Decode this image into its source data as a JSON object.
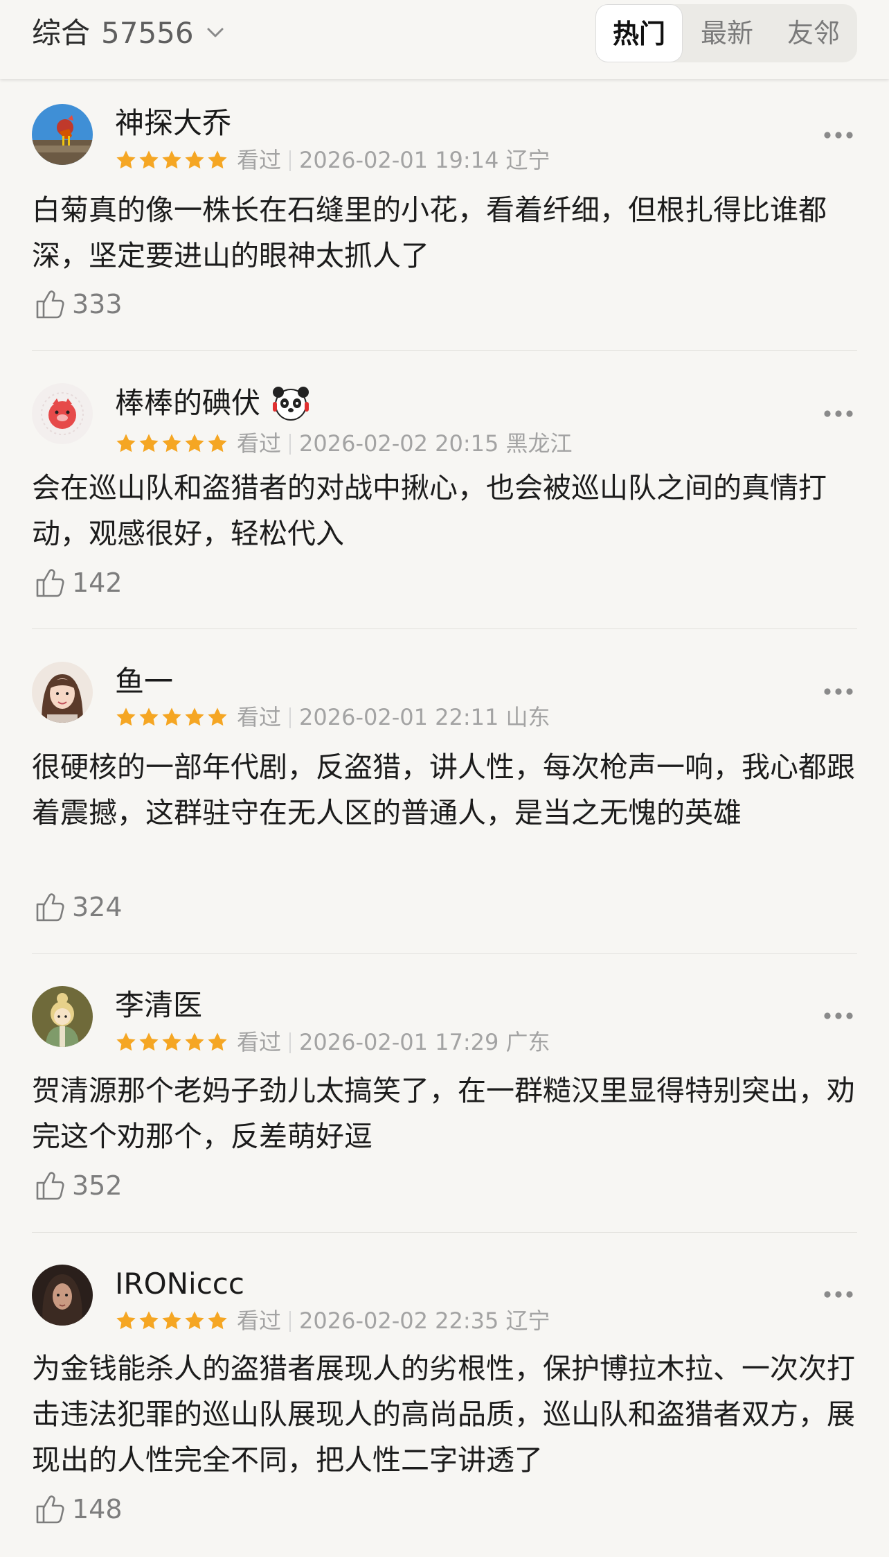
{
  "header": {
    "sort_label": "综合",
    "count": "57556",
    "tabs": [
      {
        "label": "热门",
        "active": true
      },
      {
        "label": "最新",
        "active": false
      },
      {
        "label": "友邻",
        "active": false
      }
    ]
  },
  "colors": {
    "star": "#f5a623",
    "muted": "#a3a3a3",
    "background": "#f7f6f3"
  },
  "comments": [
    {
      "name": "神探大乔",
      "rating": 5,
      "status": "看过",
      "meta": "2026-02-01 19:14 辽宁",
      "text": "白菊真的像一株长在石缝里的小花，看着纤细，但根扎得比谁都深，坚定要进山的眼神太抓人了",
      "likes": "333"
    },
    {
      "name": "棒棒的碘伏",
      "badge_icon": "panda-badge-icon",
      "rating": 5,
      "status": "看过",
      "meta": "2026-02-02 20:15 黑龙江",
      "text": "会在巡山队和盗猎者的对战中揪心，也会被巡山队之间的真情打动，观感很好，轻松代入",
      "likes": "142"
    },
    {
      "name": "鱼一",
      "rating": 5,
      "status": "看过",
      "meta": "2026-02-01 22:11 山东",
      "text": "很硬核的一部年代剧，反盗猎，讲人性，每次枪声一响，我心都跟着震撼，这群驻守在无人区的普通人，是当之无愧的英雄",
      "likes": "324"
    },
    {
      "name": "李清医",
      "rating": 5,
      "status": "看过",
      "meta": "2026-02-01 17:29 广东",
      "text": "贺清源那个老妈子劲儿太搞笑了，在一群糙汉里显得特别突出，劝完这个劝那个，反差萌好逗",
      "likes": "352"
    },
    {
      "name": "IRONiccc",
      "rating": 5,
      "status": "看过",
      "meta": "2026-02-02 22:35 辽宁",
      "text": "为金钱能杀人的盗猎者展现人的劣根性，保护博拉木拉、一次次打击违法犯罪的巡山队展现人的高尚品质，巡山队和盗猎者双方，展现出的人性完全不同，把人性二字讲透了",
      "likes": "148"
    }
  ]
}
